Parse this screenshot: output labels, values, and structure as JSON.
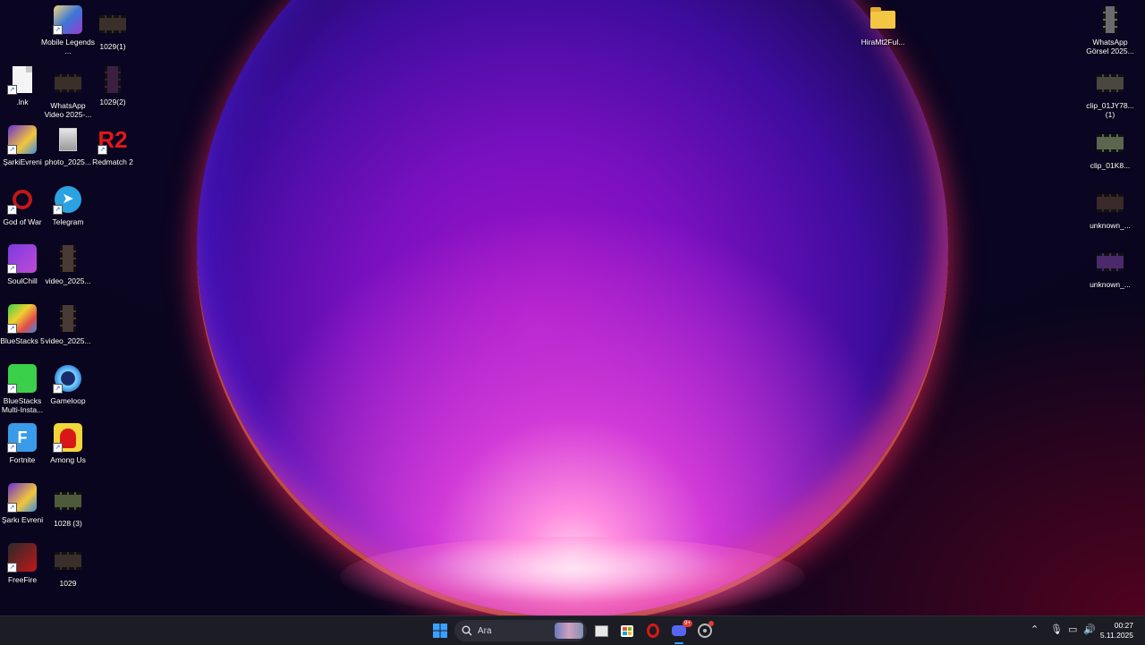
{
  "desktop": {
    "icons": [
      {
        "label": "Mobile Legends ..."
      },
      {
        "label": "1029(1)"
      },
      {
        "label": ".lnk"
      },
      {
        "label": "WhatsApp Video 2025-..."
      },
      {
        "label": "1029(2)"
      },
      {
        "label": "ŞarkiEvreni"
      },
      {
        "label": "photo_2025..."
      },
      {
        "label": "Redmatch 2"
      },
      {
        "label": "God of War"
      },
      {
        "label": "Telegram"
      },
      {
        "label": "SoulChill"
      },
      {
        "label": "video_2025..."
      },
      {
        "label": "BlueStacks 5"
      },
      {
        "label": "video_2025..."
      },
      {
        "label": "BlueStacks Multi-Insta..."
      },
      {
        "label": "Gameloop"
      },
      {
        "label": "Fortnite"
      },
      {
        "label": "Among Us"
      },
      {
        "label": "Şarkı Evreni"
      },
      {
        "label": "1028 (3)"
      },
      {
        "label": "FreeFire"
      },
      {
        "label": "1029"
      },
      {
        "label": "HiraMt2Ful..."
      },
      {
        "label": "WhatsApp Görsel 2025..."
      },
      {
        "label": "clip_01JY78... (1)"
      },
      {
        "label": "clip_01K8..."
      },
      {
        "label": "unknown_..."
      },
      {
        "label": "unknown_..."
      }
    ],
    "redmatch_logo_text": "R2"
  },
  "taskbar": {
    "search_placeholder": "Ara",
    "discord_badge": "9+",
    "icons": [
      "windows-start-icon",
      "search-icon",
      "search-highlight-icon",
      "task-view-icon",
      "microsoft-store-icon",
      "opera-icon",
      "discord-icon",
      "chrome-icon"
    ],
    "tray_icons": [
      "chevron-up-icon",
      "microphone-icon",
      "display-icon",
      "speaker-icon"
    ],
    "clock": {
      "time": "00:27",
      "date": "5.11.2025"
    }
  },
  "colors": {
    "taskbar_bg": "#1c1c24",
    "wallpaper_bg": "#0a051e",
    "accent_windows": "#3aa0ff"
  }
}
